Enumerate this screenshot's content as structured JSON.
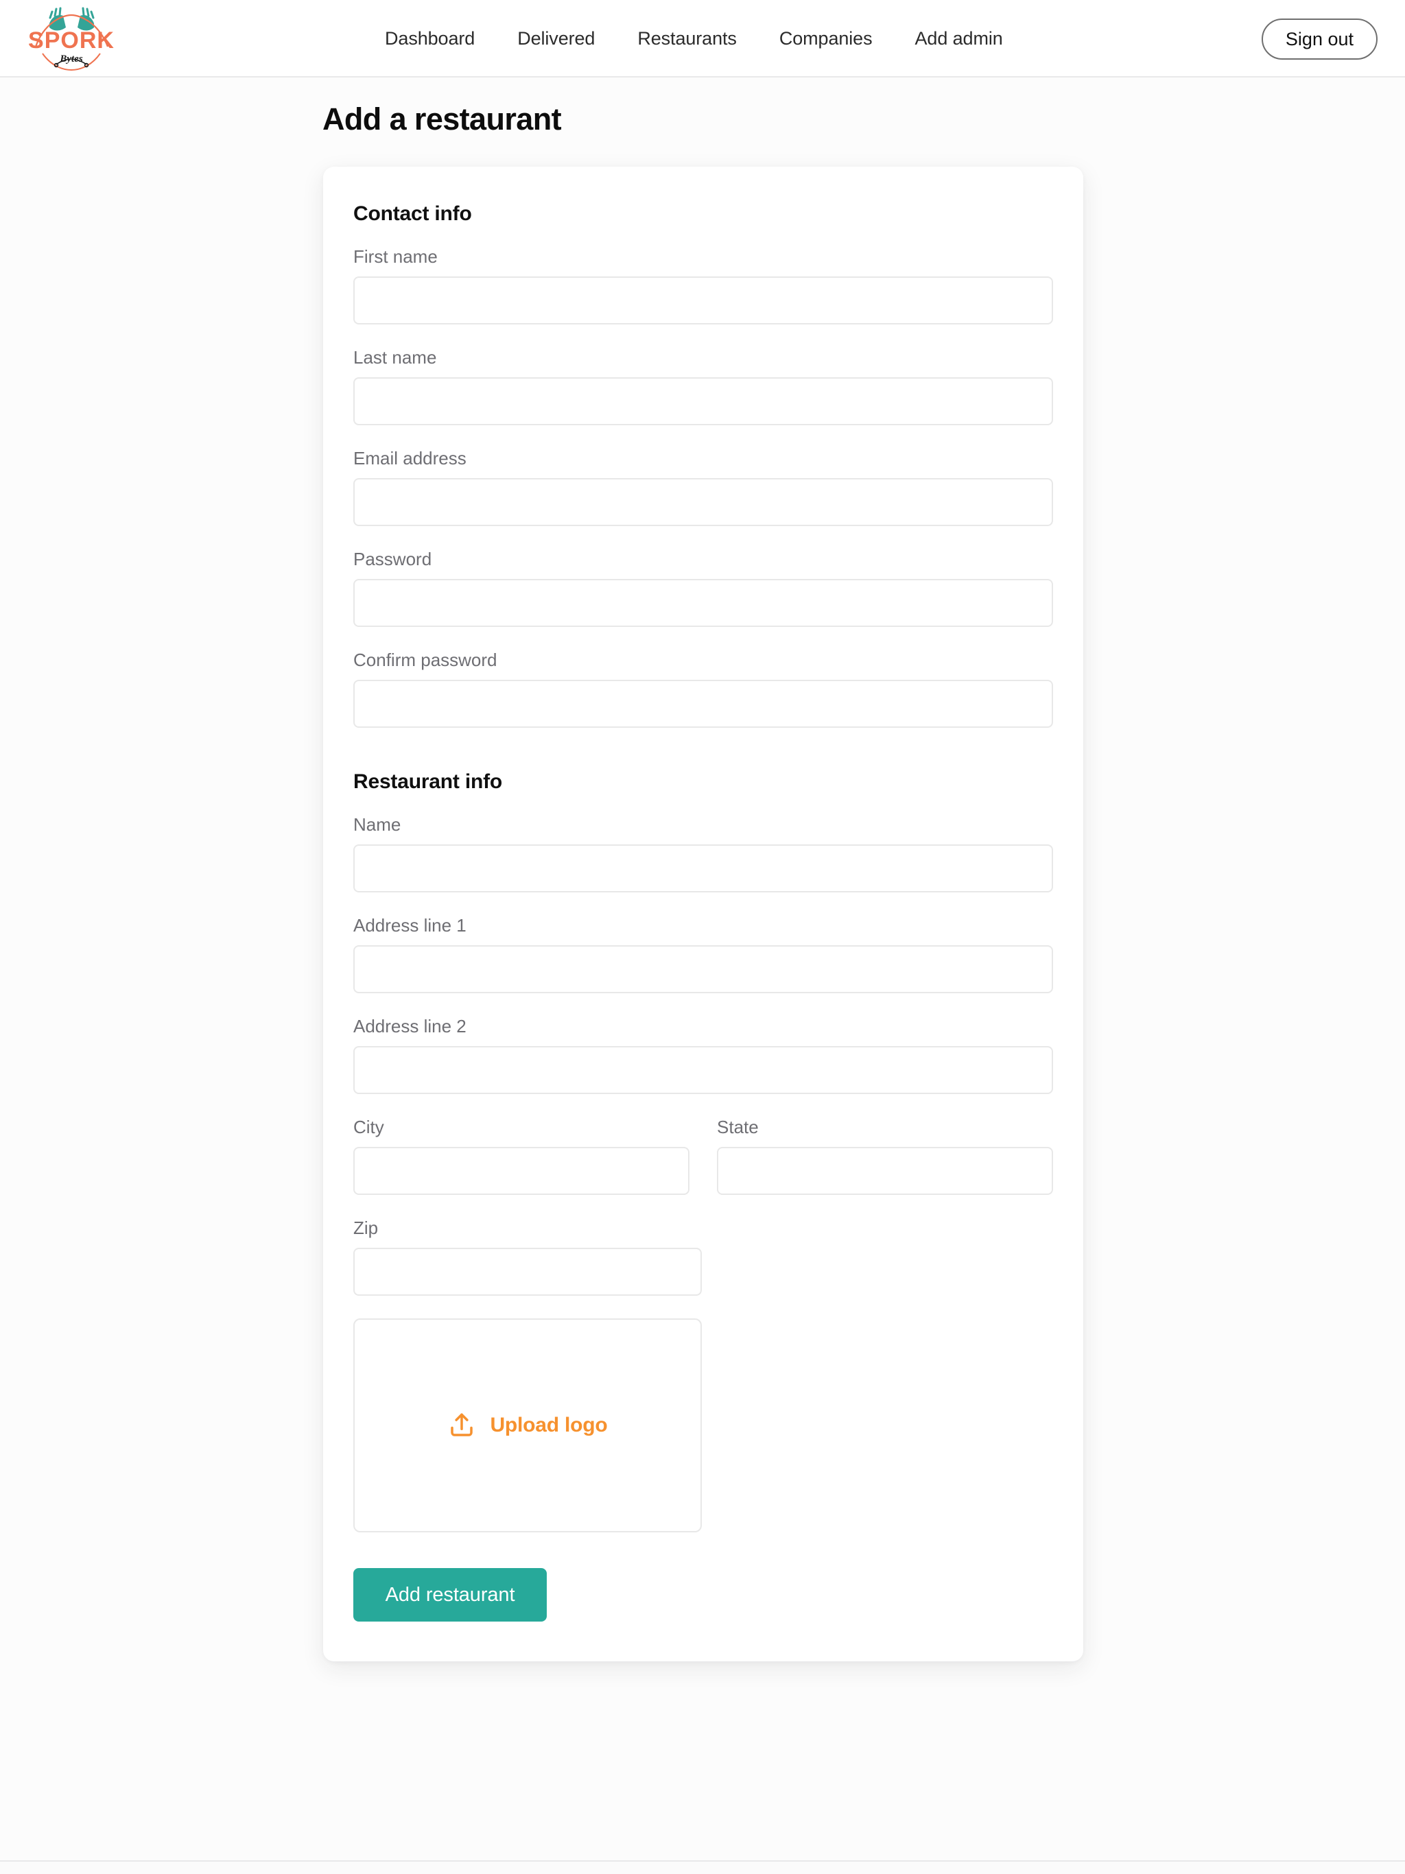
{
  "brand": {
    "name": "SPORK",
    "subtitle": "Bytes",
    "colors": {
      "word": "#ef7350",
      "utensils": "#34a497",
      "arc": "#ef7350"
    }
  },
  "header": {
    "nav": [
      {
        "label": "Dashboard",
        "name": "nav-dashboard"
      },
      {
        "label": "Delivered",
        "name": "nav-delivered"
      },
      {
        "label": "Restaurants",
        "name": "nav-restaurants"
      },
      {
        "label": "Companies",
        "name": "nav-companies"
      },
      {
        "label": "Add admin",
        "name": "nav-add-admin"
      }
    ],
    "sign_out_label": "Sign out"
  },
  "page": {
    "title": "Add a restaurant"
  },
  "form": {
    "contact_section_title": "Contact info",
    "restaurant_section_title": "Restaurant info",
    "contact_fields": [
      {
        "label": "First name",
        "value": "",
        "placeholder": "",
        "type": "text",
        "name": "first-name-input"
      },
      {
        "label": "Last name",
        "value": "",
        "placeholder": "",
        "type": "text",
        "name": "last-name-input"
      },
      {
        "label": "Email address",
        "value": "",
        "placeholder": "",
        "type": "email",
        "name": "email-input"
      },
      {
        "label": "Password",
        "value": "",
        "placeholder": "",
        "type": "password",
        "name": "password-input"
      },
      {
        "label": "Confirm password",
        "value": "",
        "placeholder": "",
        "type": "password",
        "name": "confirm-password-input"
      }
    ],
    "restaurant_fields": [
      {
        "label": "Name",
        "value": "",
        "placeholder": "",
        "type": "text",
        "name": "restaurant-name-input"
      },
      {
        "label": "Address line 1",
        "value": "",
        "placeholder": "",
        "type": "text",
        "name": "address-line-1-input"
      },
      {
        "label": "Address line 2",
        "value": "",
        "placeholder": "",
        "type": "text",
        "name": "address-line-2-input"
      }
    ],
    "city_field": {
      "label": "City",
      "value": "",
      "placeholder": "",
      "type": "text",
      "name": "city-input"
    },
    "state_field": {
      "label": "State",
      "value": "",
      "placeholder": "",
      "type": "text",
      "name": "state-input"
    },
    "zip_field": {
      "label": "Zip",
      "value": "",
      "placeholder": "",
      "type": "text",
      "name": "zip-input"
    },
    "upload": {
      "label": "Upload logo",
      "icon": "upload-icon",
      "color": "#f6912e"
    },
    "submit_label": "Add restaurant",
    "submit_color": "#27a99a"
  }
}
